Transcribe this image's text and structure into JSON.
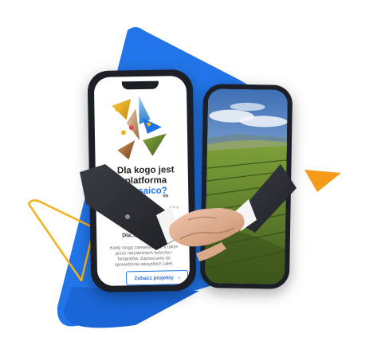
{
  "app": {
    "heading_line1": "Dla kogo jest",
    "heading_line2": "platforma",
    "heading_accent": "Mosaico?",
    "fragment_top": "im",
    "fragment_mid": "ę e-ą",
    "section_title": "Dla...",
    "paragraph": "Kiedy mogą zainwestować, a także przez niezależnych twórców i fotografów. Zapraszamy do sprawdzenia wszystkich zalet.",
    "cta_label": "Zobacz projekty",
    "cta_arrow": "›"
  },
  "colors": {
    "blue_triangle": "#1e72e8",
    "orange_triangle": "#f59a1a",
    "yellow_outline": "#f2b21d",
    "accent_text": "#1e72e8"
  },
  "icons": {
    "cta": "chevron-right-icon",
    "handshake": "handshake-illustration"
  }
}
